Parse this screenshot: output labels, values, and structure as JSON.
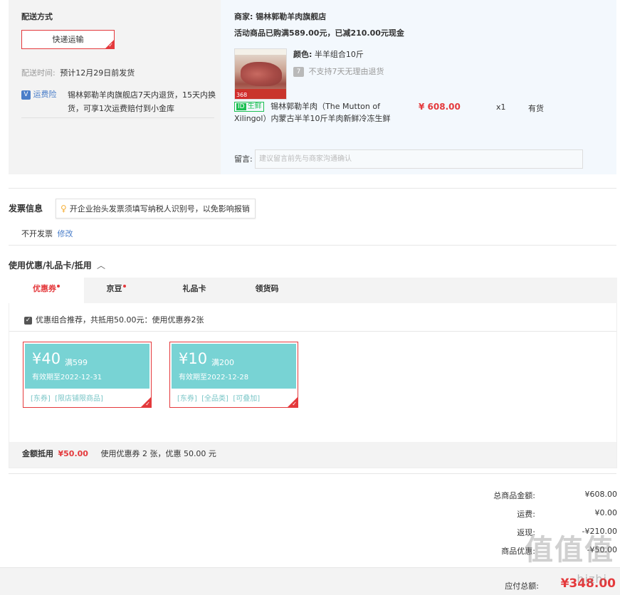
{
  "delivery": {
    "title": "配送方式",
    "method_button": "快递运输",
    "time_label": "配送时间:",
    "time_value": "预计12月29日前发货",
    "insurance_label": "运费险",
    "insurance_icon_text": "V",
    "insurance_desc_line1": "锡林郭勒羊肉旗舰店7天内退货，15天内换",
    "insurance_desc_line2": "货，可享1次运费赔付到小金库"
  },
  "shop": {
    "merchant_label": "商家:",
    "merchant_name": "锡林郭勒羊肉旗舰店",
    "promotion": "活动商品已购满589.00元，已减210.00元现金",
    "product": {
      "color_label": "颜色:",
      "color_value": "半羊组合10斤",
      "no_return_icon": "7",
      "no_return_text": "不支持7天无理由退货",
      "badge_icon": "ID",
      "badge_text": "生鲜",
      "tag_368": "368",
      "name_line1": "锡林郭勒羊肉（The Mutton of",
      "name_line2": "Xilingol）内蒙古半羊10斤羊肉新鲜冷冻生鲜",
      "price": "¥ 608.00",
      "quantity": "x1",
      "stock": "有货"
    },
    "note_label": "留言:",
    "note_placeholder": "建议留言前先与商家沟通确认"
  },
  "invoice": {
    "title": "发票信息",
    "tip": "开企业抬头发票须填写纳税人识别号，以免影响报销",
    "status": "不开发票",
    "edit_link": "修改"
  },
  "coupons": {
    "title": "使用优惠/礼品卡/抵用",
    "tabs": [
      {
        "label": "优惠券",
        "dot": true
      },
      {
        "label": "京豆",
        "dot": true
      },
      {
        "label": "礼品卡",
        "dot": false
      },
      {
        "label": "领货码",
        "dot": false
      }
    ],
    "recommend": "优惠组合推荐，共抵用50.00元：使用优惠券2张",
    "list": [
      {
        "amount": "¥40",
        "condition": "满599",
        "expiry": "有效期至2022-12-31",
        "tags": "[东券]  [限店铺限商品]"
      },
      {
        "amount": "¥10",
        "condition": "满200",
        "expiry": "有效期至2022-12-28",
        "tags": "[东券]  [全品类]  [可叠加]"
      }
    ],
    "deduct_label": "金额抵用",
    "deduct_value": "¥50.00",
    "deduct_desc": "使用优惠券 2 张，优惠 50.00 元"
  },
  "summary": {
    "rows": [
      {
        "label": "总商品金额:",
        "value": "¥608.00"
      },
      {
        "label": "运费:",
        "value": "¥0.00"
      },
      {
        "label": "返现:",
        "value": "-¥210.00"
      },
      {
        "label": "商品优惠:",
        "value": "-¥50.00"
      }
    ],
    "payable_label": "应付总额:",
    "payable_value": "¥348.00"
  },
  "watermark": {
    "main": "值值值",
    "sub": "hizhi"
  },
  "colors": {
    "accent_red": "#e4393c",
    "coupon_teal": "#78d3d4",
    "link_blue": "#4a7ec9",
    "fresh_green": "#1cbf52"
  }
}
